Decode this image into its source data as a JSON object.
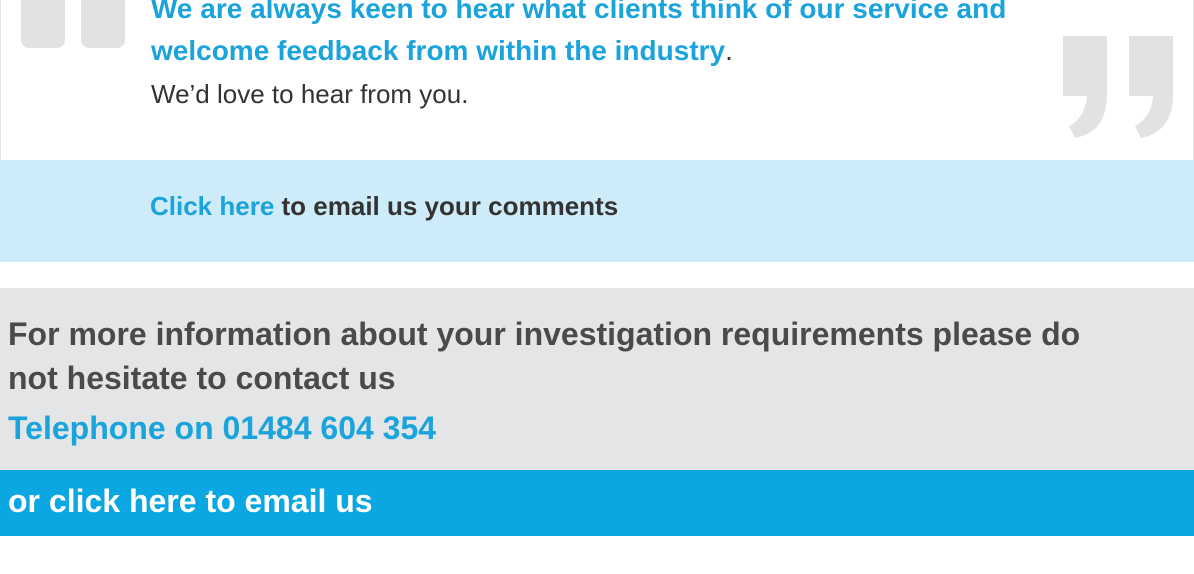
{
  "feedback": {
    "lead_text": "We are always keen to hear what clients think of our service and welcome feedback from within the industry",
    "lead_punct": ".",
    "sub_text": "We’d love to hear from you.",
    "open_quote_icon": "open-quote-icon",
    "close_quote_icon": "close-quote-icon"
  },
  "comments": {
    "link_label": "Click here",
    "rest_text": " to email us your comments"
  },
  "contact": {
    "info_text": "For more information about your investigation requirements please do not hesitate to contact us",
    "telephone_text": "Telephone on 01484 604 354",
    "email_link_text": "or click here to email us"
  },
  "colors": {
    "accent_blue": "#1ba3dc",
    "bar_blue": "#0aa7e2",
    "light_blue_band": "#cdebf8",
    "grey_panel": "#e4e5e7",
    "quote_grey": "#e2e2e2"
  }
}
